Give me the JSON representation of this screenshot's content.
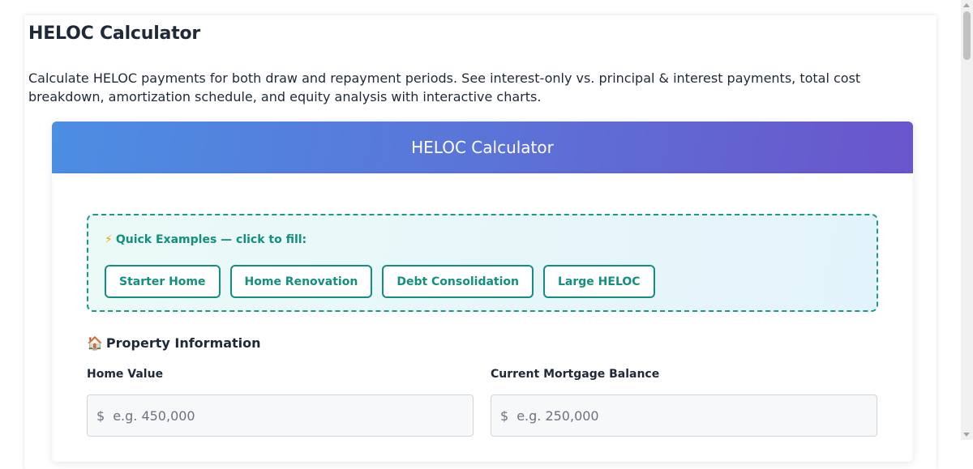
{
  "page": {
    "title": "HELOC Calculator",
    "description": "Calculate HELOC payments for both draw and repayment periods. See interest-only vs. principal & interest payments, total cost breakdown, amortization schedule, and equity analysis with interactive charts."
  },
  "calculator": {
    "header": "HELOC Calculator",
    "quick_examples": {
      "icon": "⚡",
      "title": "Quick Examples — click to fill:",
      "buttons": [
        "Starter Home",
        "Home Renovation",
        "Debt Consolidation",
        "Large HELOC"
      ]
    },
    "property_section": {
      "icon": "🏠",
      "title": "Property Information",
      "home_value": {
        "label": "Home Value",
        "prefix": "$",
        "placeholder": "e.g. 450,000",
        "value": ""
      },
      "mortgage_balance": {
        "label": "Current Mortgage Balance",
        "prefix": "$",
        "placeholder": "e.g. 250,000",
        "value": ""
      }
    }
  },
  "colors": {
    "accent_teal": "#12907f",
    "header_gradient_start": "#4c8ee2",
    "header_gradient_end": "#6a55cc"
  }
}
